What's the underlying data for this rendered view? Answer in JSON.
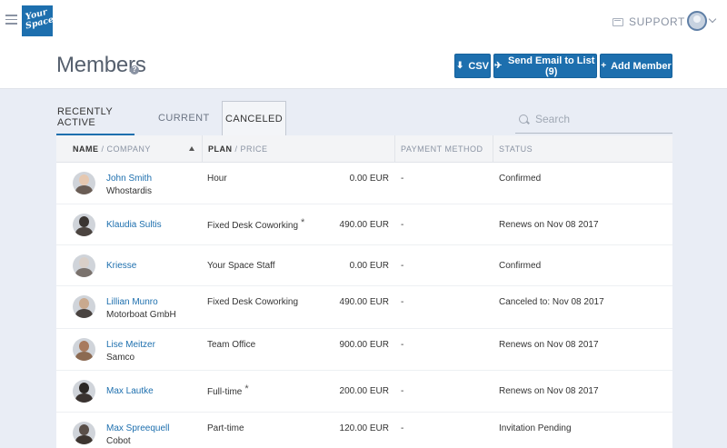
{
  "header": {
    "logo_line1": "Your",
    "logo_line2": "Space",
    "support_label": "SUPPORT",
    "page_title": "Members"
  },
  "actions": {
    "csv_label": "CSV",
    "email_label": "Send Email to List (9)",
    "add_label": "Add Member"
  },
  "tabs": [
    {
      "label": "RECENTLY ACTIVE"
    },
    {
      "label": "CURRENT"
    },
    {
      "label": "CANCELED"
    }
  ],
  "search": {
    "placeholder": "Search"
  },
  "table": {
    "headers": {
      "name": "NAME",
      "company": "/ COMPANY",
      "plan": "PLAN",
      "price": "/ PRICE",
      "payment": "PAYMENT METHOD",
      "status": "STATUS"
    },
    "rows": [
      {
        "name": "John Smith",
        "company": "Whostardis",
        "plan": "Hour",
        "starred": false,
        "price": "0.00 EUR",
        "payment": "-",
        "status": "Confirmed"
      },
      {
        "name": "Klaudia Sultis",
        "company": "",
        "plan": "Fixed Desk Coworking",
        "starred": true,
        "price": "490.00 EUR",
        "payment": "-",
        "status": "Renews on Nov 08 2017"
      },
      {
        "name": "Kriesse",
        "company": "",
        "plan": "Your Space Staff",
        "starred": false,
        "price": "0.00 EUR",
        "payment": "-",
        "status": "Confirmed"
      },
      {
        "name": "Lillian Munro",
        "company": "Motorboat GmbH",
        "plan": "Fixed Desk Coworking",
        "starred": false,
        "price": "490.00 EUR",
        "payment": "-",
        "status": "Canceled to: Nov 08 2017"
      },
      {
        "name": "Lise Meitzer",
        "company": "Samco",
        "plan": "Team Office",
        "starred": false,
        "price": "900.00 EUR",
        "payment": "-",
        "status": "Renews on Nov 08 2017"
      },
      {
        "name": "Max Lautke",
        "company": "",
        "plan": "Full-time",
        "starred": true,
        "price": "200.00 EUR",
        "payment": "-",
        "status": "Renews on Nov 08 2017"
      },
      {
        "name": "Max Spreequell",
        "company": "Cobot",
        "plan": "Part-time",
        "starred": false,
        "price": "120.00 EUR",
        "payment": "-",
        "status": "Invitation Pending"
      }
    ],
    "star_glyph": "*"
  }
}
